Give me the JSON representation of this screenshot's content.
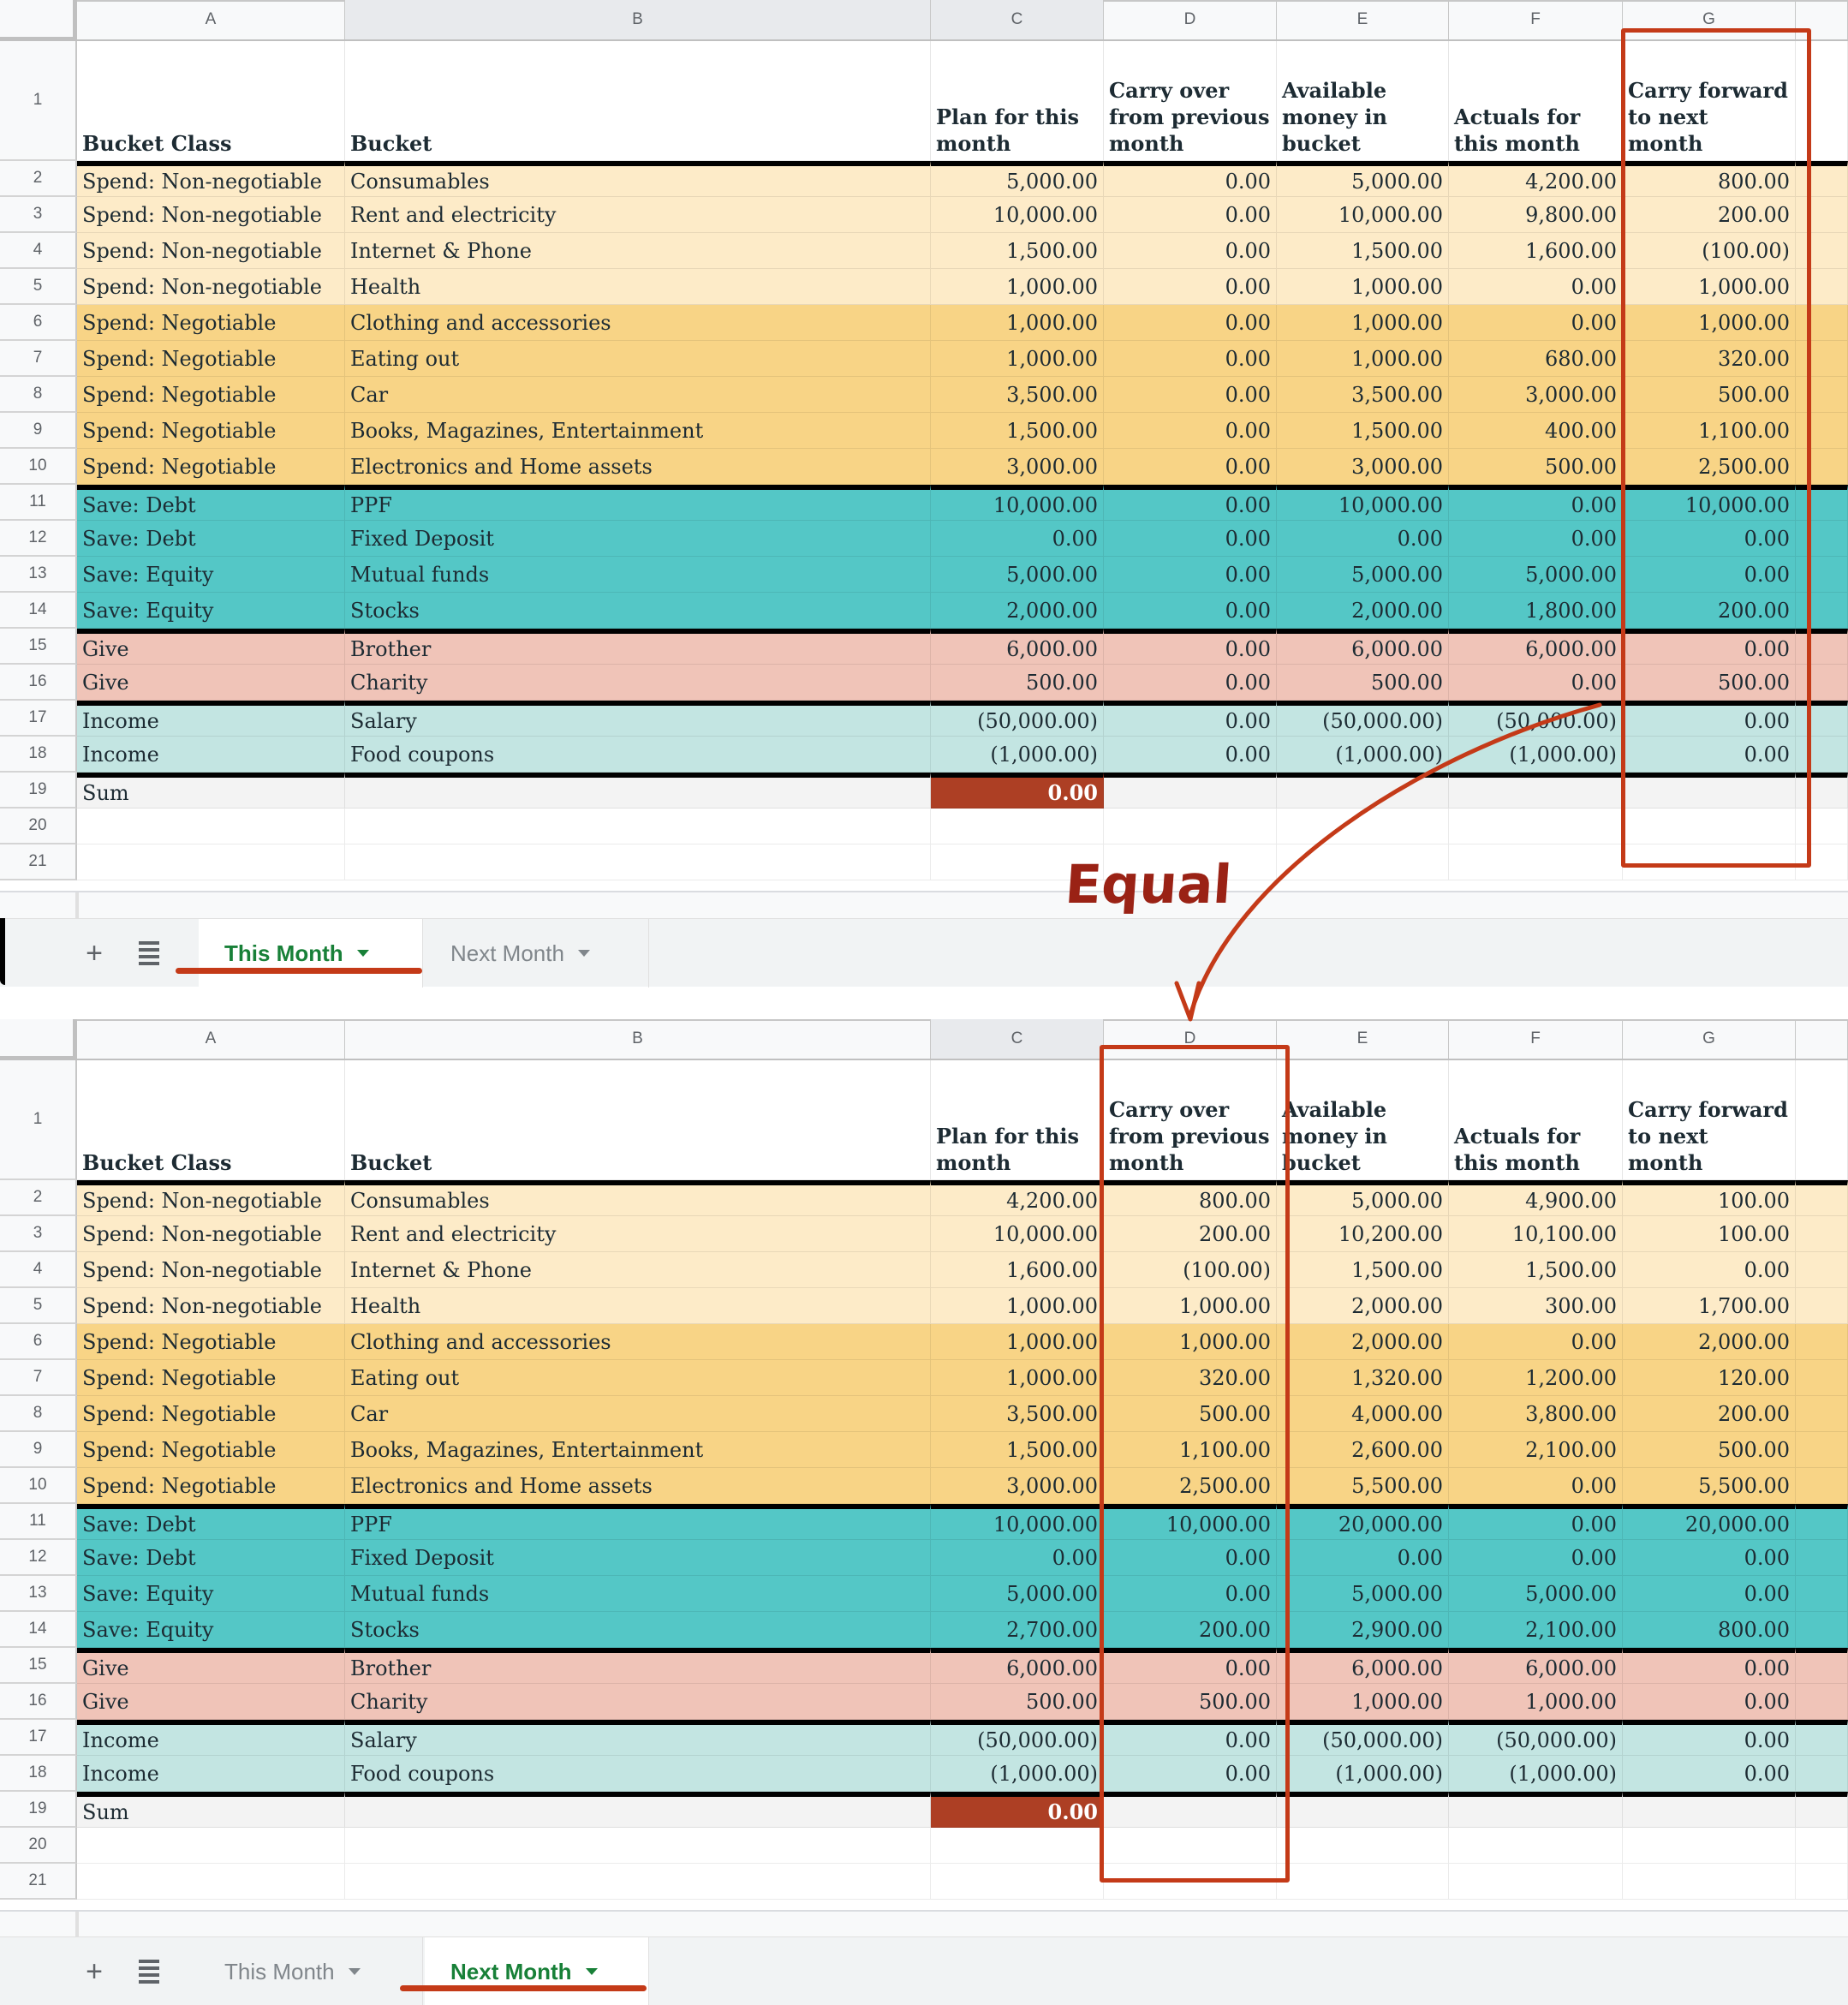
{
  "columns": [
    "A",
    "B",
    "C",
    "D",
    "E",
    "F",
    "G"
  ],
  "header_row": {
    "row_number": "1",
    "cells": [
      "Bucket Class",
      "Bucket",
      "Plan for this month",
      "Carry over from previous month",
      "Available money in bucket",
      "Actuals for this month",
      "Carry forward to next month"
    ]
  },
  "colors": {
    "spend_non_negotiable": "#fdebc8",
    "spend_negotiable": "#f8d486",
    "save": "#54c7c6",
    "give": "#f0c4b8",
    "income": "#c3e5e2",
    "sum_highlight": "#ad3f24",
    "annotation": "#c43a18",
    "active_tab": "#188038"
  },
  "sheets": [
    {
      "name": "This Month",
      "rows": [
        {
          "n": "2",
          "group": "nonneg",
          "cells": [
            "Spend: Non-negotiable",
            "Consumables",
            "5,000.00",
            "0.00",
            "5,000.00",
            "4,200.00",
            "800.00"
          ]
        },
        {
          "n": "3",
          "group": "nonneg",
          "cells": [
            "Spend: Non-negotiable",
            "Rent and electricity",
            "10,000.00",
            "0.00",
            "10,000.00",
            "9,800.00",
            "200.00"
          ]
        },
        {
          "n": "4",
          "group": "nonneg",
          "cells": [
            "Spend: Non-negotiable",
            "Internet & Phone",
            "1,500.00",
            "0.00",
            "1,500.00",
            "1,600.00",
            "(100.00)"
          ]
        },
        {
          "n": "5",
          "group": "nonneg",
          "cells": [
            "Spend: Non-negotiable",
            "Health",
            "1,000.00",
            "0.00",
            "1,000.00",
            "0.00",
            "1,000.00"
          ]
        },
        {
          "n": "6",
          "group": "neg",
          "cells": [
            "Spend: Negotiable",
            "Clothing and accessories",
            "1,000.00",
            "0.00",
            "1,000.00",
            "0.00",
            "1,000.00"
          ]
        },
        {
          "n": "7",
          "group": "neg",
          "cells": [
            "Spend: Negotiable",
            "Eating out",
            "1,000.00",
            "0.00",
            "1,000.00",
            "680.00",
            "320.00"
          ]
        },
        {
          "n": "8",
          "group": "neg",
          "cells": [
            "Spend: Negotiable",
            "Car",
            "3,500.00",
            "0.00",
            "3,500.00",
            "3,000.00",
            "500.00"
          ]
        },
        {
          "n": "9",
          "group": "neg",
          "cells": [
            "Spend: Negotiable",
            "Books, Magazines, Entertainment",
            "1,500.00",
            "0.00",
            "1,500.00",
            "400.00",
            "1,100.00"
          ]
        },
        {
          "n": "10",
          "group": "neg",
          "cells": [
            "Spend: Negotiable",
            "Electronics and Home assets",
            "3,000.00",
            "0.00",
            "3,000.00",
            "500.00",
            "2,500.00"
          ]
        },
        {
          "n": "11",
          "group": "save",
          "cells": [
            "Save: Debt",
            "PPF",
            "10,000.00",
            "0.00",
            "10,000.00",
            "0.00",
            "10,000.00"
          ]
        },
        {
          "n": "12",
          "group": "save",
          "cells": [
            "Save: Debt",
            "Fixed Deposit",
            "0.00",
            "0.00",
            "0.00",
            "0.00",
            "0.00"
          ]
        },
        {
          "n": "13",
          "group": "save",
          "cells": [
            "Save: Equity",
            "Mutual funds",
            "5,000.00",
            "0.00",
            "5,000.00",
            "5,000.00",
            "0.00"
          ]
        },
        {
          "n": "14",
          "group": "save",
          "cells": [
            "Save: Equity",
            "Stocks",
            "2,000.00",
            "0.00",
            "2,000.00",
            "1,800.00",
            "200.00"
          ]
        },
        {
          "n": "15",
          "group": "give",
          "cells": [
            "Give",
            "Brother",
            "6,000.00",
            "0.00",
            "6,000.00",
            "6,000.00",
            "0.00"
          ]
        },
        {
          "n": "16",
          "group": "give",
          "cells": [
            "Give",
            "Charity",
            "500.00",
            "0.00",
            "500.00",
            "0.00",
            "500.00"
          ]
        },
        {
          "n": "17",
          "group": "income",
          "cells": [
            "Income",
            "Salary",
            "(50,000.00)",
            "0.00",
            "(50,000.00)",
            "(50,000.00)",
            "0.00"
          ]
        },
        {
          "n": "18",
          "group": "income",
          "cells": [
            "Income",
            "Food coupons",
            "(1,000.00)",
            "0.00",
            "(1,000.00)",
            "(1,000.00)",
            "0.00"
          ]
        },
        {
          "n": "19",
          "group": "sum",
          "cells": [
            "Sum",
            "",
            "0.00",
            "",
            "",
            "",
            ""
          ]
        },
        {
          "n": "20",
          "group": "empty",
          "cells": [
            "",
            "",
            "",
            "",
            "",
            "",
            ""
          ]
        },
        {
          "n": "21",
          "group": "empty",
          "cells": [
            "",
            "",
            "",
            "",
            "",
            "",
            ""
          ]
        }
      ],
      "tabs": [
        {
          "label": "This Month",
          "active": true
        },
        {
          "label": "Next Month",
          "active": false
        }
      ]
    },
    {
      "name": "Next Month",
      "rows": [
        {
          "n": "2",
          "group": "nonneg",
          "cells": [
            "Spend: Non-negotiable",
            "Consumables",
            "4,200.00",
            "800.00",
            "5,000.00",
            "4,900.00",
            "100.00"
          ]
        },
        {
          "n": "3",
          "group": "nonneg",
          "cells": [
            "Spend: Non-negotiable",
            "Rent and electricity",
            "10,000.00",
            "200.00",
            "10,200.00",
            "10,100.00",
            "100.00"
          ]
        },
        {
          "n": "4",
          "group": "nonneg",
          "cells": [
            "Spend: Non-negotiable",
            "Internet & Phone",
            "1,600.00",
            "(100.00)",
            "1,500.00",
            "1,500.00",
            "0.00"
          ]
        },
        {
          "n": "5",
          "group": "nonneg",
          "cells": [
            "Spend: Non-negotiable",
            "Health",
            "1,000.00",
            "1,000.00",
            "2,000.00",
            "300.00",
            "1,700.00"
          ]
        },
        {
          "n": "6",
          "group": "neg",
          "cells": [
            "Spend: Negotiable",
            "Clothing and accessories",
            "1,000.00",
            "1,000.00",
            "2,000.00",
            "0.00",
            "2,000.00"
          ]
        },
        {
          "n": "7",
          "group": "neg",
          "cells": [
            "Spend: Negotiable",
            "Eating out",
            "1,000.00",
            "320.00",
            "1,320.00",
            "1,200.00",
            "120.00"
          ]
        },
        {
          "n": "8",
          "group": "neg",
          "cells": [
            "Spend: Negotiable",
            "Car",
            "3,500.00",
            "500.00",
            "4,000.00",
            "3,800.00",
            "200.00"
          ]
        },
        {
          "n": "9",
          "group": "neg",
          "cells": [
            "Spend: Negotiable",
            "Books, Magazines, Entertainment",
            "1,500.00",
            "1,100.00",
            "2,600.00",
            "2,100.00",
            "500.00"
          ]
        },
        {
          "n": "10",
          "group": "neg",
          "cells": [
            "Spend: Negotiable",
            "Electronics and Home assets",
            "3,000.00",
            "2,500.00",
            "5,500.00",
            "0.00",
            "5,500.00"
          ]
        },
        {
          "n": "11",
          "group": "save",
          "cells": [
            "Save: Debt",
            "PPF",
            "10,000.00",
            "10,000.00",
            "20,000.00",
            "0.00",
            "20,000.00"
          ]
        },
        {
          "n": "12",
          "group": "save",
          "cells": [
            "Save: Debt",
            "Fixed Deposit",
            "0.00",
            "0.00",
            "0.00",
            "0.00",
            "0.00"
          ]
        },
        {
          "n": "13",
          "group": "save",
          "cells": [
            "Save: Equity",
            "Mutual funds",
            "5,000.00",
            "0.00",
            "5,000.00",
            "5,000.00",
            "0.00"
          ]
        },
        {
          "n": "14",
          "group": "save",
          "cells": [
            "Save: Equity",
            "Stocks",
            "2,700.00",
            "200.00",
            "2,900.00",
            "2,100.00",
            "800.00"
          ]
        },
        {
          "n": "15",
          "group": "give",
          "cells": [
            "Give",
            "Brother",
            "6,000.00",
            "0.00",
            "6,000.00",
            "6,000.00",
            "0.00"
          ]
        },
        {
          "n": "16",
          "group": "give",
          "cells": [
            "Give",
            "Charity",
            "500.00",
            "500.00",
            "1,000.00",
            "1,000.00",
            "0.00"
          ]
        },
        {
          "n": "17",
          "group": "income",
          "cells": [
            "Income",
            "Salary",
            "(50,000.00)",
            "0.00",
            "(50,000.00)",
            "(50,000.00)",
            "0.00"
          ]
        },
        {
          "n": "18",
          "group": "income",
          "cells": [
            "Income",
            "Food coupons",
            "(1,000.00)",
            "0.00",
            "(1,000.00)",
            "(1,000.00)",
            "0.00"
          ]
        },
        {
          "n": "19",
          "group": "sum",
          "cells": [
            "Sum",
            "",
            "0.00",
            "",
            "",
            "",
            ""
          ]
        },
        {
          "n": "20",
          "group": "empty",
          "cells": [
            "",
            "",
            "",
            "",
            "",
            "",
            ""
          ]
        },
        {
          "n": "21",
          "group": "empty",
          "cells": [
            "",
            "",
            "",
            "",
            "",
            "",
            ""
          ]
        }
      ],
      "tabs": [
        {
          "label": "This Month",
          "active": false
        },
        {
          "label": "Next Month",
          "active": true
        }
      ]
    }
  ],
  "annotation": {
    "label": "Equal",
    "from": "This Month column G (Carry forward to next month)",
    "to": "Next Month column D (Carry over from previous month)"
  },
  "icons": {
    "add_sheet": "plus-icon",
    "all_sheets": "list-icon",
    "tab_menu": "caret-down-icon"
  }
}
